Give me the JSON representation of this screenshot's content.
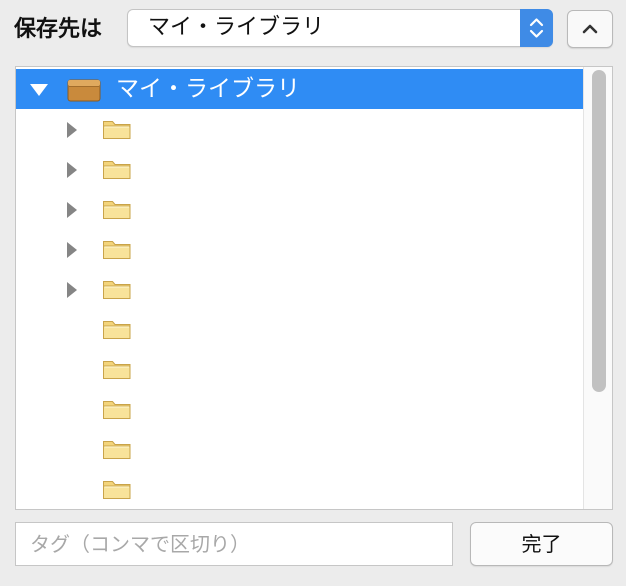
{
  "header": {
    "save_label": "保存先は",
    "destination": "マイ・ライブラリ"
  },
  "tree": {
    "root": {
      "label": "マイ・ライブラリ",
      "icon": "library-box-icon",
      "expanded": true,
      "selected": true
    },
    "children": [
      {
        "icon": "folder-icon",
        "label": "",
        "expandable": true
      },
      {
        "icon": "folder-icon",
        "label": "",
        "expandable": true
      },
      {
        "icon": "folder-icon",
        "label": "",
        "expandable": true
      },
      {
        "icon": "folder-icon",
        "label": "",
        "expandable": true
      },
      {
        "icon": "folder-icon",
        "label": "",
        "expandable": true
      },
      {
        "icon": "folder-icon",
        "label": "",
        "expandable": false
      },
      {
        "icon": "folder-icon",
        "label": "",
        "expandable": false
      },
      {
        "icon": "folder-icon",
        "label": "",
        "expandable": false
      },
      {
        "icon": "folder-icon",
        "label": "",
        "expandable": false
      },
      {
        "icon": "folder-icon",
        "label": "",
        "expandable": false
      }
    ]
  },
  "footer": {
    "tags_placeholder": "タグ（コンマで区切り）",
    "tags_value": "",
    "done_label": "完了"
  },
  "colors": {
    "selection": "#2f8cf4",
    "stepper": "#3f8be6",
    "folder": "#f3d47a",
    "library_box": "#c98a3c"
  }
}
